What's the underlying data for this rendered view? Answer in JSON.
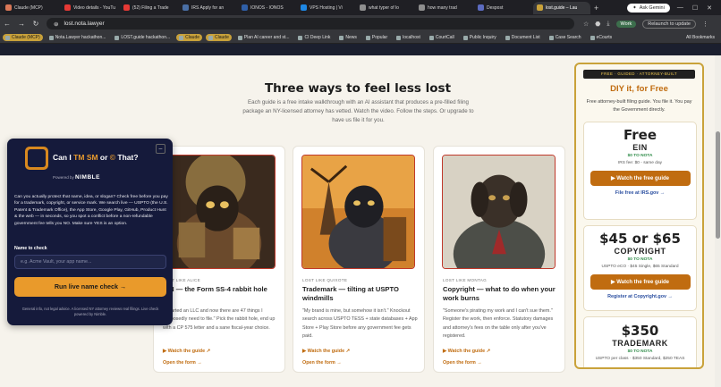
{
  "browser": {
    "tabs": [
      {
        "label": "Claude (MCP)",
        "color": "#d97757"
      },
      {
        "label": "Video details - YouTu",
        "color": "#e53935"
      },
      {
        "label": "(52) Filing a Trade",
        "color": "#e53935"
      },
      {
        "label": "IRS Apply for an",
        "color": "#4a6fa5"
      },
      {
        "label": "IONOS - IONOS",
        "color": "#2f5fa7"
      },
      {
        "label": "VPS Hosting | Vi",
        "color": "#1e88e5"
      },
      {
        "label": "what typer of lo",
        "color": "#8e8e8e"
      },
      {
        "label": "how many trad",
        "color": "#8e8e8e"
      },
      {
        "label": "Despost",
        "color": "#5c6bc0"
      },
      {
        "label": "lost.guide – Lau",
        "color": "#c9a23a"
      }
    ],
    "gemini_label": "Ask Gemini",
    "url": "lost.nota.lawyer",
    "profile_label": "Work",
    "relaunch_label": "Relaunch to update",
    "bookmarks": [
      {
        "label": "Claude (MCP)",
        "highlight": true
      },
      {
        "label": "Nota.Lawyer hackathon...",
        "highlight": false
      },
      {
        "label": "LOST.guide hackathon...",
        "highlight": false
      },
      {
        "label": "Claude",
        "highlight": true
      },
      {
        "label": "Claude",
        "highlight": true
      },
      {
        "label": "Plan AI career and st...",
        "highlight": false
      },
      {
        "label": "CI Deep Link",
        "highlight": false
      },
      {
        "label": "News",
        "highlight": false
      },
      {
        "label": "Popular",
        "highlight": false
      },
      {
        "label": "localhost",
        "highlight": false
      },
      {
        "label": "CourtCall",
        "highlight": false
      },
      {
        "label": "Public Inquiry",
        "highlight": false
      },
      {
        "label": "Document List",
        "highlight": false
      },
      {
        "label": "Case Search",
        "highlight": false
      },
      {
        "label": "eCourts",
        "highlight": false
      }
    ],
    "all_bookmarks": "All Bookmarks"
  },
  "main": {
    "title": "Three ways to feel less lost",
    "intro": "Each guide is a free intake walkthrough with an AI assistant that produces a pre-filled filing package an NY-licensed attorney has vetted. Watch the video. Follow the steps. Or upgrade to have us file it for you.",
    "cards": [
      {
        "kicker": "LOST LIKE ALICE",
        "title": "EIN — the Form SS-4 rabbit hole",
        "quote": "\"I started an LLC and now there are 47 things I supposedly need to file.\" Pick the rabbit hole, end up with a CP 575 letter and a sane fiscal-year choice.",
        "guide": "▶ Watch the guide ↗",
        "open": "Open the form →"
      },
      {
        "kicker": "LOST LIKE QUIXOTE",
        "title": "Trademark — tilting at USPTO windmills",
        "quote": "\"My brand is mine, but somehow it isn't.\" Knockout search across USPTO TESS + state databases + App Store + Play Store before any government fee gets paid.",
        "guide": "▶ Watch the guide ↗",
        "open": "Open the form →"
      },
      {
        "kicker": "LOST LIKE MONTAG",
        "title": "Copyright — what to do when your work burns",
        "quote": "\"Someone's pirating my work and I can't sue them.\" Register the work, then enforce. Statutory damages and attorney's fees on the table only after you've registered.",
        "guide": "▶ Watch the guide ↗",
        "open": "Open the form →"
      }
    ]
  },
  "sidebar": {
    "badge": "FREE · GUIDED · ATTORNEY-BUILT",
    "title": "DIY it, for Free",
    "subtitle": "Free attorney-built filing guide. You file it. You pay the Government directly.",
    "offers": [
      {
        "big": "Free",
        "label": "EIN",
        "tag": "$0 TO NOTA",
        "note": "IRS fee: $0 - same day",
        "button": "▶ Watch the free guide",
        "link": "File free at IRS.gov →"
      },
      {
        "big": "$45 or $65",
        "label": "COPYRIGHT",
        "tag": "$0 TO NOTA",
        "note": "USPTO eCO · $45 Single, $65 Standard",
        "button": "▶ Watch the free guide",
        "link": "Register at Copyright.gov →"
      },
      {
        "big": "$350",
        "label": "TRADEMARK",
        "tag": "$0 TO NOTA",
        "note": "USPTO per class · $350 Standard, $250 TEAS",
        "button": "",
        "link": ""
      }
    ]
  },
  "popup": {
    "title_pre": "Can I ",
    "title_tm": "TM",
    "title_sm": "SM",
    "title_or": " or ",
    "title_c": "©",
    "title_post": " That?",
    "powered_by": "Powered by",
    "brand": "NIMBLE",
    "description": "Can you actually protect that name, idea, or slogan? Check free before you pay for a trademark, copyright, or service mark. We search live — USPTO (the U.S. Patent & Trademark Office), the App Store, Google Play, GitHub, Product Hunt & the web — in seconds, so you spot a conflict before a non-refundable government fee tells you NO. Make sure YES is an option.",
    "name_label": "Name to check",
    "name_placeholder": "e.g. Acme Vault, your app name...",
    "check_button": "Run live name check →",
    "fine_print": "General info, not legal advice. A licensed NY attorney reviews real filings. Live check powered by Nimble."
  },
  "colors": {
    "accent": "#c06c10",
    "popup_bg": "#151a3b",
    "popup_button": "#e99a2b",
    "sidebar_border": "#c9a23a",
    "free_tag": "#2c8a46"
  }
}
